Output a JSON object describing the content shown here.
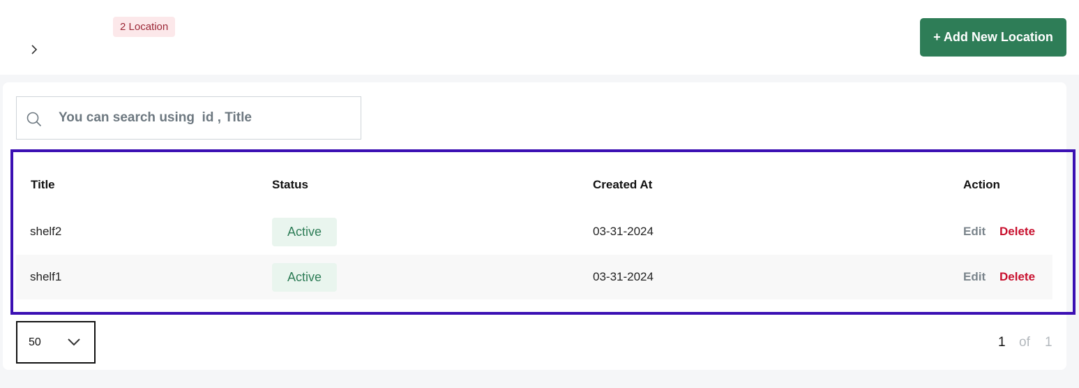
{
  "header": {
    "breadcrumb_icon": "chevron-right-icon",
    "location_count": "2 Location",
    "add_button_label": "+ Add New Location"
  },
  "search": {
    "icon": "search-icon",
    "placeholder": "You can search using  id , Title"
  },
  "table": {
    "headers": [
      "Title",
      "Status",
      "Created At",
      "Action"
    ],
    "rows": [
      {
        "title": "shelf2",
        "status": "Active",
        "created_at": "03-31-2024",
        "edit": "Edit",
        "delete": "Delete"
      },
      {
        "title": "shelf1",
        "status": "Active",
        "created_at": "03-31-2024",
        "edit": "Edit",
        "delete": "Delete"
      }
    ]
  },
  "pagination": {
    "per_page": "50",
    "current_page": "1",
    "of_label": "of",
    "total_pages": "1"
  },
  "colors": {
    "primary": "#2e7d57",
    "danger": "#c8102e",
    "highlight_border": "#3b0fb3",
    "status_bg": "#e9f5ee"
  }
}
